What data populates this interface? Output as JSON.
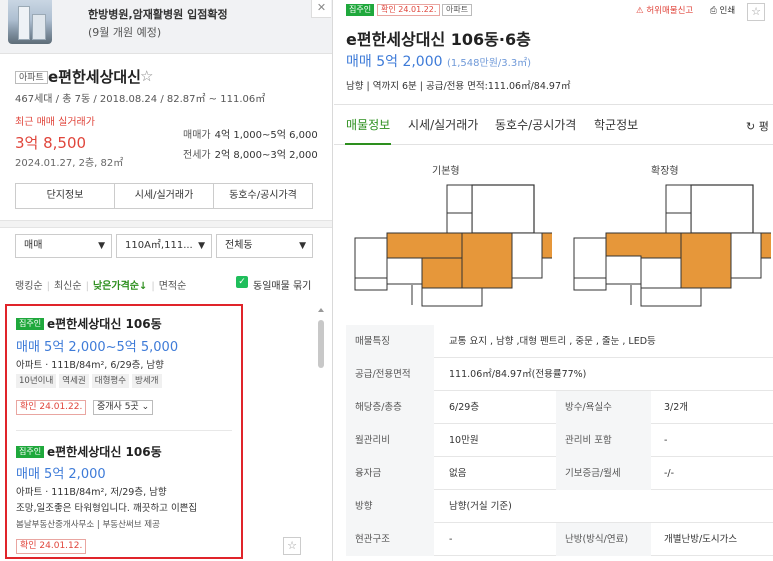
{
  "banner": {
    "title": "한방병원,암재활병원 입점확정",
    "subtitle": "(9월 개원 예정)",
    "close_icon": "close-icon"
  },
  "complex": {
    "type_tag": "아파트",
    "name": "e편한세상대신",
    "star": "☆",
    "info": "467세대 / 총 7동 / 2018.08.24 / 82.87㎡ ~ 111.06㎡",
    "recent_label": "최근 매매 실거래가",
    "recent_price": "3억 8,500",
    "recent_date": "2024.01.27, 2층, 82㎡",
    "sale_label": "매매가",
    "sale_range": "4억 1,000~5억 6,000",
    "rent_label": "전세가",
    "rent_range": "2억 8,000~3억 2,000",
    "tabs": [
      "단지정보",
      "시세/실거래가",
      "동호수/공시가격"
    ]
  },
  "filters": {
    "trade": "매매",
    "area": "110A㎡,111...",
    "dong": "전체동",
    "chevron": "⌄"
  },
  "sort": {
    "ranking": "랭킹순",
    "latest": "최신순",
    "low_price": "낮은가격순↓",
    "area": "면적순",
    "bundle_label": "동일매물 묶기",
    "check": "✓"
  },
  "listings": [
    {
      "badge": "집주인",
      "name": "e편한세상대신 106동",
      "price": "매매 5억 2,000~5억 5,000",
      "spec": "아파트 · 111B/84m², 6/29층, 남향",
      "chips": [
        "10년이내",
        "역세권",
        "대형평수",
        "방세개"
      ],
      "confirm": "확인 24.01.22.",
      "agents": "중개사 5곳 ⌄"
    },
    {
      "badge": "집주인",
      "name": "e편한세상대신 106동",
      "price": "매매 5억 2,000",
      "spec": "아파트 · 111B/84m², 저/29층, 남향",
      "desc": "조망,일조좋은 타워형입니다. 깨끗하고 이쁜집",
      "source": "봄날부동산중개사무소 | 부동산써브 제공",
      "confirm": "확인 24.01.12."
    }
  ],
  "detail": {
    "badge_owner": "집주인",
    "badge_confirm": "확인 24.01.22.",
    "badge_type": "아파트",
    "report": "허위매물신고",
    "print": "인쇄",
    "title": "e편한세상대신 106동·6층",
    "price": "매매 5억 2,000",
    "price_unit": "(1,548만원/3.3㎡)",
    "info": "남향 | 역까지 6분 | 공급/전용 면적:111.06㎡/84.97㎡",
    "tabs": [
      "매물정보",
      "시세/실거래가",
      "동호수/공시가격",
      "학군정보"
    ],
    "refresh": "↻ 평",
    "plan_basic": "기본형",
    "plan_extended": "확장형",
    "table": {
      "feature_k": "매물특징",
      "feature_v": "교통 요지 , 남향 ,대형 펜트리 , 중문 , 줄눈 , LED등",
      "area_k": "공급/전용면적",
      "area_v": "111.06㎡/84.97㎡(전용률77%)",
      "floor_k": "해당층/총층",
      "floor_v": "6/29층",
      "rooms_k": "방수/욕실수",
      "rooms_v": "3/2개",
      "mgmt_k": "월관리비",
      "mgmt_v": "10만원",
      "mgmt_inc_k": "관리비 포함",
      "mgmt_inc_v": "-",
      "loan_k": "융자금",
      "loan_v": "없음",
      "deposit_k": "기보증금/월세",
      "deposit_v": "-/-",
      "dir_k": "방향",
      "dir_v": "남향(거실 기준)",
      "entry_k": "현관구조",
      "entry_v": "-",
      "heat_k": "난방(방식/연료)",
      "heat_v": "개별난방/도시가스"
    }
  },
  "colors": {
    "accent_green": "#2d8f1e",
    "price_blue": "#3e7bd8",
    "alert_red": "#e0463c",
    "highlight_border": "#e0242a"
  }
}
